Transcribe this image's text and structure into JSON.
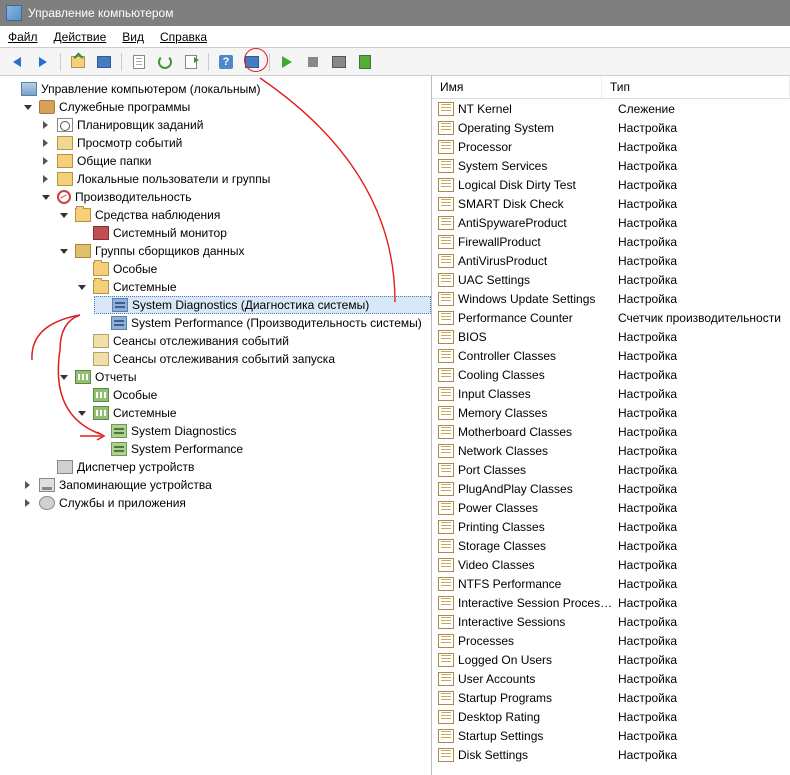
{
  "window": {
    "title": "Управление компьютером"
  },
  "menu": {
    "file": "Файл",
    "action": "Действие",
    "view": "Вид",
    "help": "Справка"
  },
  "tree": {
    "root": "Управление компьютером (локальным)",
    "sysutils": "Служебные программы",
    "taskscheduler": "Планировщик заданий",
    "eventviewer": "Просмотр событий",
    "sharedfolders": "Общие папки",
    "localusers": "Локальные пользователи и группы",
    "performance": "Производительность",
    "monitortools": "Средства наблюдения",
    "sysmonitor": "Системный монитор",
    "dcsets": "Группы сборщиков данных",
    "custom": "Особые",
    "system": "Системные",
    "sysdiag": "System Diagnostics (Диагностика системы)",
    "sysperf": "System Performance (Производительность системы)",
    "evtsess": "Сеансы отслеживания событий",
    "evtsessstart": "Сеансы отслеживания событий запуска",
    "reports": "Отчеты",
    "reports_custom": "Особые",
    "reports_system": "Системные",
    "r_sysdiag": "System Diagnostics",
    "r_sysperf": "System Performance",
    "devmgr": "Диспетчер устройств",
    "storage": "Запоминающие устройства",
    "services": "Службы и приложения"
  },
  "list": {
    "col_name": "Имя",
    "col_type": "Тип",
    "rows": [
      {
        "name": "NT Kernel",
        "type": "Слежение"
      },
      {
        "name": "Operating System",
        "type": "Настройка"
      },
      {
        "name": "Processor",
        "type": "Настройка"
      },
      {
        "name": "System Services",
        "type": "Настройка"
      },
      {
        "name": "Logical Disk Dirty Test",
        "type": "Настройка"
      },
      {
        "name": "SMART Disk Check",
        "type": "Настройка"
      },
      {
        "name": "AntiSpywareProduct",
        "type": "Настройка"
      },
      {
        "name": "FirewallProduct",
        "type": "Настройка"
      },
      {
        "name": "AntiVirusProduct",
        "type": "Настройка"
      },
      {
        "name": "UAC Settings",
        "type": "Настройка"
      },
      {
        "name": "Windows Update Settings",
        "type": "Настройка"
      },
      {
        "name": "Performance Counter",
        "type": "Счетчик производительности"
      },
      {
        "name": "BIOS",
        "type": "Настройка"
      },
      {
        "name": "Controller Classes",
        "type": "Настройка"
      },
      {
        "name": "Cooling Classes",
        "type": "Настройка"
      },
      {
        "name": "Input Classes",
        "type": "Настройка"
      },
      {
        "name": "Memory Classes",
        "type": "Настройка"
      },
      {
        "name": "Motherboard Classes",
        "type": "Настройка"
      },
      {
        "name": "Network Classes",
        "type": "Настройка"
      },
      {
        "name": "Port Classes",
        "type": "Настройка"
      },
      {
        "name": "PlugAndPlay Classes",
        "type": "Настройка"
      },
      {
        "name": "Power Classes",
        "type": "Настройка"
      },
      {
        "name": "Printing Classes",
        "type": "Настройка"
      },
      {
        "name": "Storage Classes",
        "type": "Настройка"
      },
      {
        "name": "Video Classes",
        "type": "Настройка"
      },
      {
        "name": "NTFS Performance",
        "type": "Настройка"
      },
      {
        "name": "Interactive Session Processes",
        "type": "Настройка"
      },
      {
        "name": "Interactive Sessions",
        "type": "Настройка"
      },
      {
        "name": "Processes",
        "type": "Настройка"
      },
      {
        "name": "Logged On Users",
        "type": "Настройка"
      },
      {
        "name": "User Accounts",
        "type": "Настройка"
      },
      {
        "name": "Startup Programs",
        "type": "Настройка"
      },
      {
        "name": "Desktop Rating",
        "type": "Настройка"
      },
      {
        "name": "Startup Settings",
        "type": "Настройка"
      },
      {
        "name": "Disk Settings",
        "type": "Настройка"
      }
    ]
  }
}
